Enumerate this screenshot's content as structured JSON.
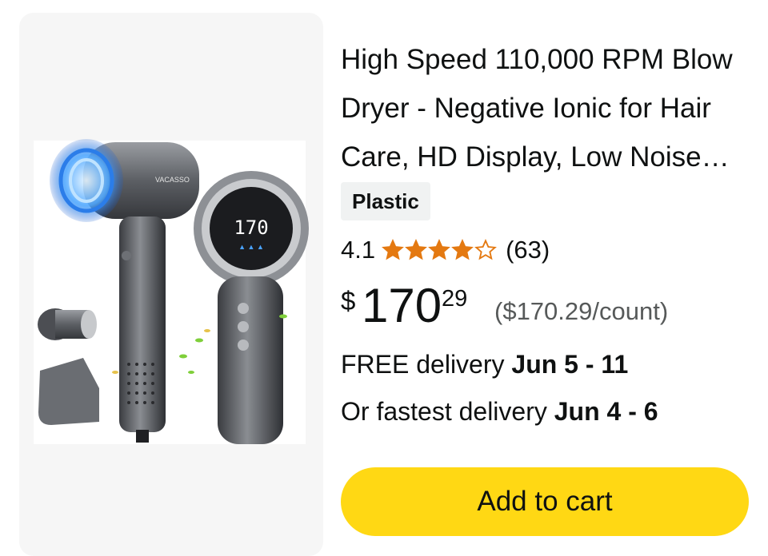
{
  "product": {
    "title": "High Speed 110,000 RPM Blow Dryer - Negative Ionic for Hair Care, HD Display, Low Noise Hair Dryer with Magnetic Nozzle",
    "material_chip": "Plastic",
    "image": {
      "brand_text": "VACASSO",
      "display_text": "170"
    }
  },
  "rating": {
    "value": "4.1",
    "stars_filled": 4.1,
    "stars_total": 5,
    "count": "(63)",
    "star_color": "#e47911"
  },
  "price": {
    "symbol": "$",
    "whole": "170",
    "fraction": "29",
    "unit_price": "($170.29/count)"
  },
  "delivery": {
    "free_prefix": "FREE delivery",
    "free_dates": "Jun 5 - 11",
    "fastest_prefix": "Or fastest delivery",
    "fastest_dates": "Jun 4 - 6"
  },
  "actions": {
    "add_to_cart": "Add to cart",
    "button_color": "#ffd814"
  }
}
